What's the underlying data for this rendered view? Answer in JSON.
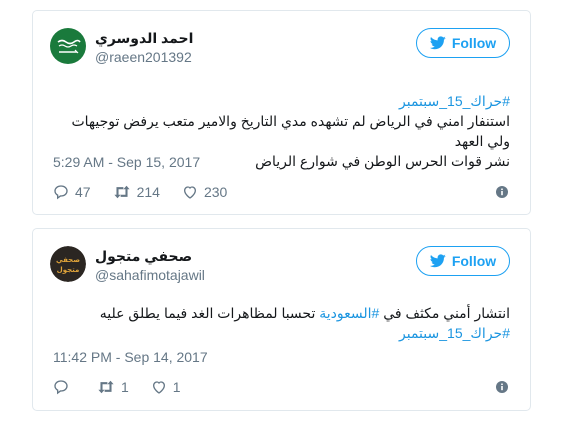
{
  "colors": {
    "brand_blue": "#1da1f2",
    "hashtag_blue": "#1b95e0",
    "muted": "#657786",
    "border": "#e1e8ed"
  },
  "tweets": [
    {
      "author_name": "احمد الدوسري",
      "handle": "@raeen201392",
      "avatar_icon": "saudi-flag-avatar",
      "follow_label": "Follow",
      "hashtag_line": "#حراك_15_سبتمبر",
      "body_line_1": "استنفار امني في الرياض لم تشهده مدي التاريخ والامير متعب يرفض توجيهات ولي العهد",
      "body_line_2": "نشر قوات الحرس الوطن في شوارع الرياض",
      "timestamp": "5:29 AM - Sep 15, 2017",
      "replies": "47",
      "retweets": "214",
      "likes": "230"
    },
    {
      "author_name": "صحفي متجول",
      "handle": "@sahafimotajawil",
      "avatar_icon": "sahafi-logo-avatar",
      "avatar_text_top": "صحفي",
      "avatar_text_bottom": "متجول",
      "follow_label": "Follow",
      "body_prefix": "انتشار أمني مكثف في ",
      "body_hashtag": "#السعودية",
      "body_suffix": " تحسبا لمظاهرات الغد فيما يطلق عليه",
      "hashtag_line": "#حراك_15_سبتمبر",
      "timestamp": "11:42 PM - Sep 14, 2017",
      "replies": "",
      "retweets": "1",
      "likes": "1"
    }
  ]
}
